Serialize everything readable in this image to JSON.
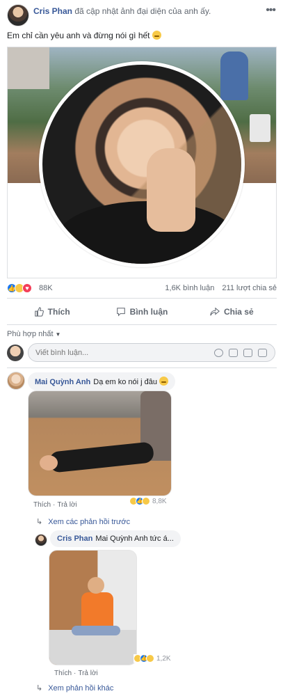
{
  "post": {
    "author": "Cris Phan",
    "action_text": "đã cập nhật ảnh đại diện của anh ấy.",
    "caption": "Em chỉ cần yêu anh và đừng nói gì hết",
    "more_icon": "more-dots-icon"
  },
  "stats": {
    "reaction_count": "88K",
    "comments": "1,6K bình luận",
    "shares": "211 lượt chia sẻ"
  },
  "actions": {
    "like": "Thích",
    "comment": "Bình luận",
    "share": "Chia sẻ"
  },
  "comments_section": {
    "sort_label": "Phù hợp nhất",
    "input_placeholder": "Viết bình luận...",
    "comment1": {
      "author": "Mai Quỳnh Anh",
      "text": "Dạ em ko nói j đâu",
      "like": "Thích",
      "reply": "Trả lời",
      "reaction_count": "8,8K"
    },
    "view_previous_replies": "Xem các phản hồi trước",
    "reply1": {
      "author": "Cris Phan",
      "text": "Mai Quỳnh Anh tức á...",
      "like": "Thích",
      "reply": "Trả lời",
      "reaction_count": "1,2K"
    },
    "view_other_replies": "Xem phản hồi khác"
  },
  "colors": {
    "link_blue": "#385898",
    "like_blue": "#1877f2",
    "love_red": "#f33e58",
    "haha_yellow": "#f7c948"
  }
}
